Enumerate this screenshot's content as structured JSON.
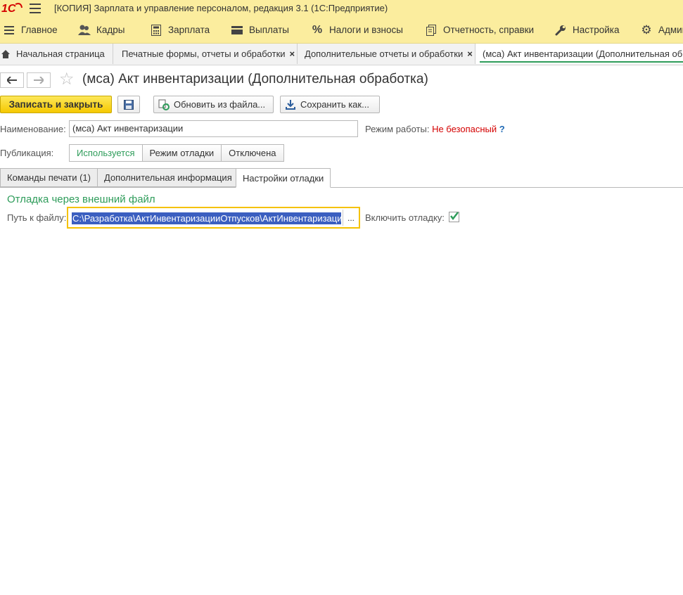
{
  "window": {
    "title": "[КОПИЯ] Зарплата и управление персоналом, редакция 3.1  (1С:Предприятие)",
    "logo_text": "1С"
  },
  "sections": [
    {
      "label": "Главное",
      "icon": "menu-icon"
    },
    {
      "label": "Кадры",
      "icon": "people-icon"
    },
    {
      "label": "Зарплата",
      "icon": "calculator-icon"
    },
    {
      "label": "Выплаты",
      "icon": "wallet-icon"
    },
    {
      "label": "Налоги и взносы",
      "icon": "percent-icon"
    },
    {
      "label": "Отчетность, справки",
      "icon": "documents-icon"
    },
    {
      "label": "Настройка",
      "icon": "wrench-icon"
    },
    {
      "label": "Админ",
      "icon": "gear-icon"
    }
  ],
  "window_tabs": [
    {
      "label": "Начальная страница",
      "icon": "home-icon"
    },
    {
      "label": "Печатные формы, отчеты и обработки",
      "close": "×"
    },
    {
      "label": "Дополнительные отчеты и обработки",
      "close": "×"
    },
    {
      "label": "(мса) Акт инвентаризации (Дополнительная обр"
    }
  ],
  "form": {
    "title": "(мса) Акт инвентаризации (Дополнительная обработка)",
    "buttons": {
      "save_close": "Записать и закрыть",
      "reload": "Обновить из файла...",
      "save_as": "Сохранить как..."
    },
    "name_label": "Наименование:",
    "name_value": "(мса) Акт инвентаризации",
    "mode_label": "Режим работы:",
    "mode_value": "Не безопасный",
    "mode_help": "?",
    "publication_label": "Публикация:",
    "publication_options": [
      "Используется",
      "Режим отладки",
      "Отключена"
    ],
    "publication_selected": "Используется",
    "tabs": [
      "Команды печати (1)",
      "Дополнительная информация",
      "Настройки отладки"
    ],
    "active_tab": "Настройки отладки",
    "debug": {
      "group_title": "Отладка через внешний файл",
      "path_label": "Путь к файлу:",
      "path_value": "C:\\Разработка\\АктИнвентаризацииОтпусков\\АктИнвентаризации",
      "choose_button": "...",
      "enable_label": "Включить отладку:",
      "enable_checked": true
    }
  },
  "colors": {
    "header_bg": "#fbed9e",
    "accent_green": "#2e9c5a",
    "primary_button": "#f5c800",
    "danger": "#d40000"
  }
}
